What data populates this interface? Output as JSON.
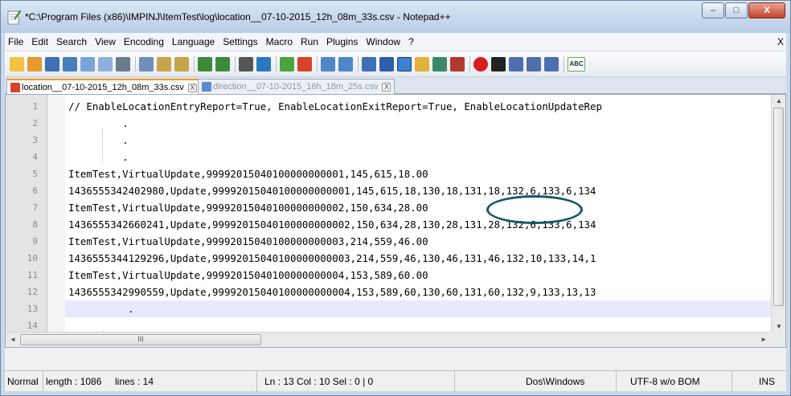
{
  "window": {
    "title": "*C:\\Program Files (x86)\\IMPINJ\\ItemTest\\log\\location__07-10-2015_12h_08m_33s.csv - Notepad++",
    "minimize": "‒",
    "maximize": "□",
    "close": "X"
  },
  "menu": {
    "items": [
      "File",
      "Edit",
      "Search",
      "View",
      "Encoding",
      "Language",
      "Settings",
      "Macro",
      "Run",
      "Plugins",
      "Window",
      "?"
    ],
    "close": "X"
  },
  "toolbar": {
    "icons": [
      "new-file-icon",
      "open-file-icon",
      "save-icon",
      "save-all-icon",
      "close-icon",
      "close-all-icon",
      "print-icon",
      "cut-icon",
      "copy-icon",
      "paste-icon",
      "undo-icon",
      "redo-icon",
      "find-icon",
      "replace-icon",
      "zoom-in-icon",
      "zoom-out-icon",
      "sync-vertical-icon",
      "sync-horizontal-icon",
      "word-wrap-icon",
      "show-all-chars-icon",
      "indent-guide-icon",
      "user-defined-lang-icon",
      "doc-map-icon",
      "function-list-icon",
      "record-macro-icon",
      "stop-record-icon",
      "play-macro-icon",
      "run-macro-multiple-icon",
      "save-macro-icon",
      "spellcheck-icon"
    ],
    "spellcheck_label": "ABC"
  },
  "tabs": [
    {
      "label": "location__07-10-2015_12h_08m_33s.csv",
      "active": true,
      "color": "#d9422a"
    },
    {
      "label": "direction__07-10-2015_16h_18m_25s.csv",
      "active": false,
      "color": "#5b8bd1"
    }
  ],
  "tab_close": "X",
  "editor": {
    "lines": [
      {
        "num": "1",
        "text": "// EnableLocationEntryReport=True, EnableLocationExitReport=True, EnableLocationUpdateRep"
      },
      {
        "num": "2",
        "text": "         ."
      },
      {
        "num": "3",
        "text": "         ."
      },
      {
        "num": "4",
        "text": "         ."
      },
      {
        "num": "5",
        "text": "ItemTest,VirtualUpdate,99992015040100000000001,145,615,18.00"
      },
      {
        "num": "6",
        "text": "1436555342402980,Update,99992015040100000000001,145,615,18,130,18,131,18,132,6,133,6,134"
      },
      {
        "num": "7",
        "text": "ItemTest,VirtualUpdate,99992015040100000000002,150,634,28.00"
      },
      {
        "num": "8",
        "text": "1436555342660241,Update,99992015040100000000002,150,634,28,130,28,131,28,132,6,133,6,134"
      },
      {
        "num": "9",
        "text": "ItemTest,VirtualUpdate,99992015040100000000003,214,559,46.00"
      },
      {
        "num": "10",
        "text": "1436555344129296,Update,99992015040100000000003,214,559,46,130,46,131,46,132,10,133,14,1"
      },
      {
        "num": "11",
        "text": "ItemTest,VirtualUpdate,99992015040100000000004,153,589,60.00"
      },
      {
        "num": "12",
        "text": "1436555342990559,Update,99992015040100000000004,153,589,60,130,60,131,60,132,9,133,13,13"
      },
      {
        "num": "13",
        "text": "."
      },
      {
        "num": "14",
        "text": ""
      }
    ],
    "scroll_left": "◄",
    "scroll_right": "►",
    "scroll_up": "▲",
    "scroll_down": "▼",
    "hthumb_grip": "III"
  },
  "status": {
    "mode": "Normal",
    "length": "length : 1086",
    "lines": "lines : 14",
    "position": "Ln : 13   Col : 10   Sel : 0 | 0",
    "eol": "Dos\\Windows",
    "encoding": "UTF-8 w/o BOM",
    "insert": "INS"
  }
}
